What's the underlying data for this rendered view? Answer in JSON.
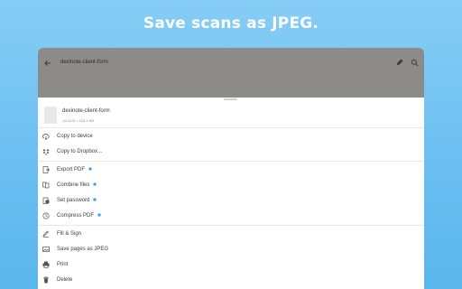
{
  "headline": "Save scans as JPEG.",
  "appbar": {
    "title": "dexinote-client-form"
  },
  "file": {
    "name": "dexinote-client-form",
    "meta": "11/11/21 • 124.4 KB"
  },
  "menu": [
    {
      "label": "Copy to device",
      "icon": "cloud-download-icon",
      "premium": false
    },
    {
      "label": "Copy to Dropbox...",
      "icon": "dropbox-icon",
      "premium": false
    },
    {
      "label": "Export PDF",
      "icon": "export-pdf-icon",
      "premium": true
    },
    {
      "label": "Combine files",
      "icon": "combine-files-icon",
      "premium": true
    },
    {
      "label": "Set password",
      "icon": "lock-icon",
      "premium": true
    },
    {
      "label": "Compress PDF",
      "icon": "compress-icon",
      "premium": true
    },
    {
      "label": "Fill & Sign",
      "icon": "fill-sign-icon",
      "premium": false
    },
    {
      "label": "Save pages as JPEG",
      "icon": "image-icon",
      "premium": false
    },
    {
      "label": "Print",
      "icon": "print-icon",
      "premium": false
    },
    {
      "label": "Delete",
      "icon": "trash-icon",
      "premium": false
    }
  ],
  "colors": {
    "accent": "#2680eb",
    "appbar": "#8c8b8a",
    "background": "#6cbff1"
  }
}
